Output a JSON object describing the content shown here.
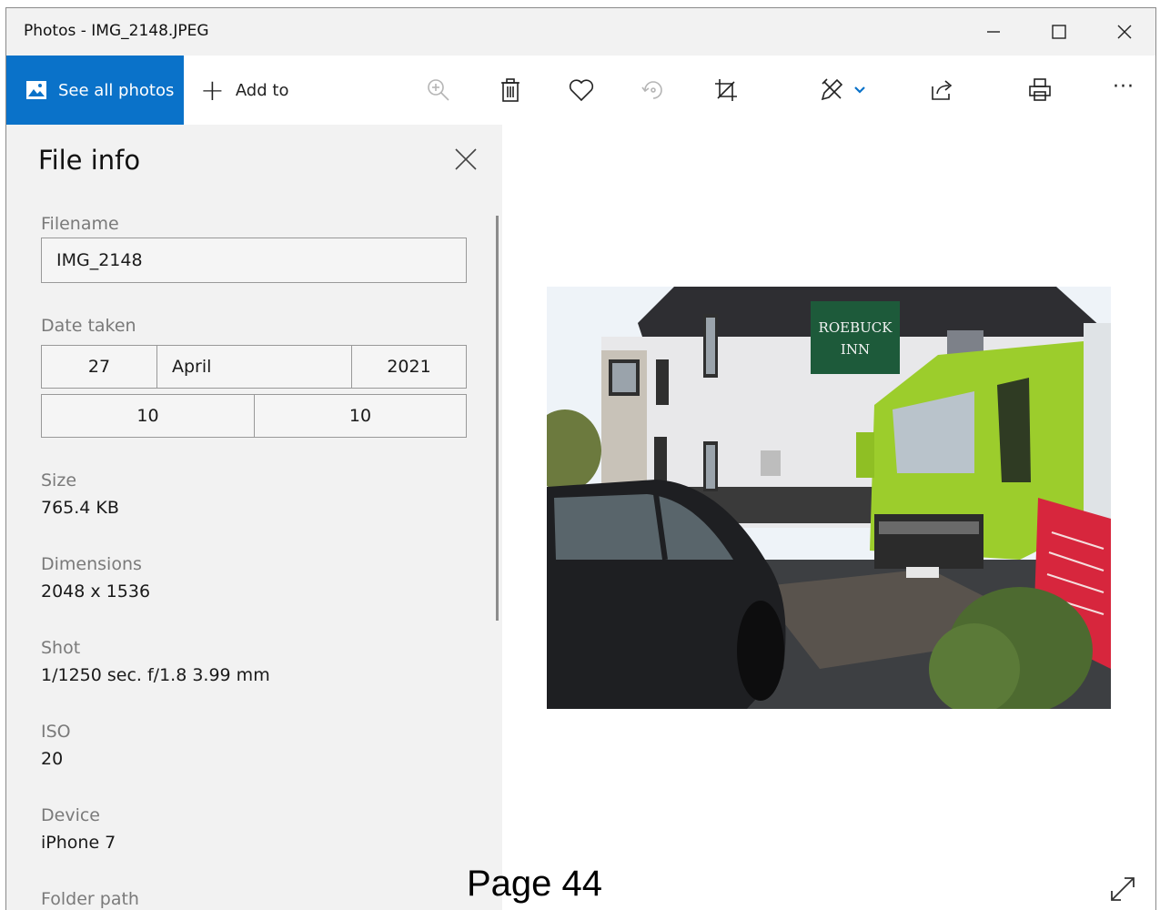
{
  "window": {
    "title": "Photos - IMG_2148.JPEG"
  },
  "toolbar": {
    "see_all_label": "See all photos",
    "add_to_label": "Add to",
    "more_label": "···"
  },
  "file_info": {
    "title": "File info",
    "filename_label": "Filename",
    "filename_value": "IMG_2148",
    "date_taken_label": "Date taken",
    "date": {
      "day": "27",
      "month": "April",
      "year": "2021"
    },
    "time": {
      "hour": "10",
      "minute": "10"
    },
    "size_label": "Size",
    "size_value": "765.4 KB",
    "dimensions_label": "Dimensions",
    "dimensions_value": "2048 x 1536",
    "shot_label": "Shot",
    "shot_value": "1/1250 sec. f/1.8 3.99 mm",
    "iso_label": "ISO",
    "iso_value": "20",
    "device_label": "Device",
    "device_value": "iPhone 7",
    "folder_label": "Folder path"
  },
  "photo": {
    "sign_line1": "ROEBUCK",
    "sign_line2": "INN",
    "colors": {
      "truck": "#9ccd2c",
      "sign_green": "#1d5a3a",
      "red_sign": "#d7263d"
    }
  },
  "page_label": "Page 44",
  "colors": {
    "accent": "#0a72c9",
    "panel_bg": "#f2f2f2"
  }
}
